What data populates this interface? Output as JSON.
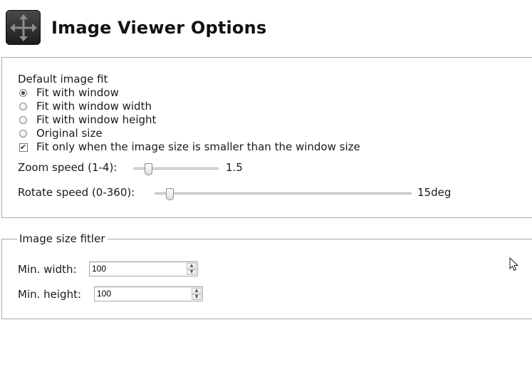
{
  "header": {
    "title": "Image Viewer Options",
    "icon": "move-arrows-icon"
  },
  "fit_section": {
    "label": "Default image fit",
    "options": [
      {
        "label": "Fit with window",
        "checked": true
      },
      {
        "label": "Fit with window width",
        "checked": false
      },
      {
        "label": "Fit with window height",
        "checked": false
      },
      {
        "label": "Original size",
        "checked": false
      }
    ],
    "only_smaller": {
      "label": "Fit only when the image size is smaller than the window size",
      "checked": true
    },
    "zoom_speed": {
      "label": "Zoom speed (1-4):",
      "value": "1.5",
      "fraction": 0.17
    },
    "rotate_speed": {
      "label": "Rotate speed (0-360):",
      "value": "15deg",
      "fraction": 0.055
    }
  },
  "size_filter": {
    "legend": "Image size fitler",
    "min_width": {
      "label": "Min. width:",
      "value": "100"
    },
    "min_height": {
      "label": "Min. height:",
      "value": "100"
    }
  },
  "colors": {
    "radio_dot": "#2b4f78",
    "panel_border": "#a8a8a8"
  }
}
